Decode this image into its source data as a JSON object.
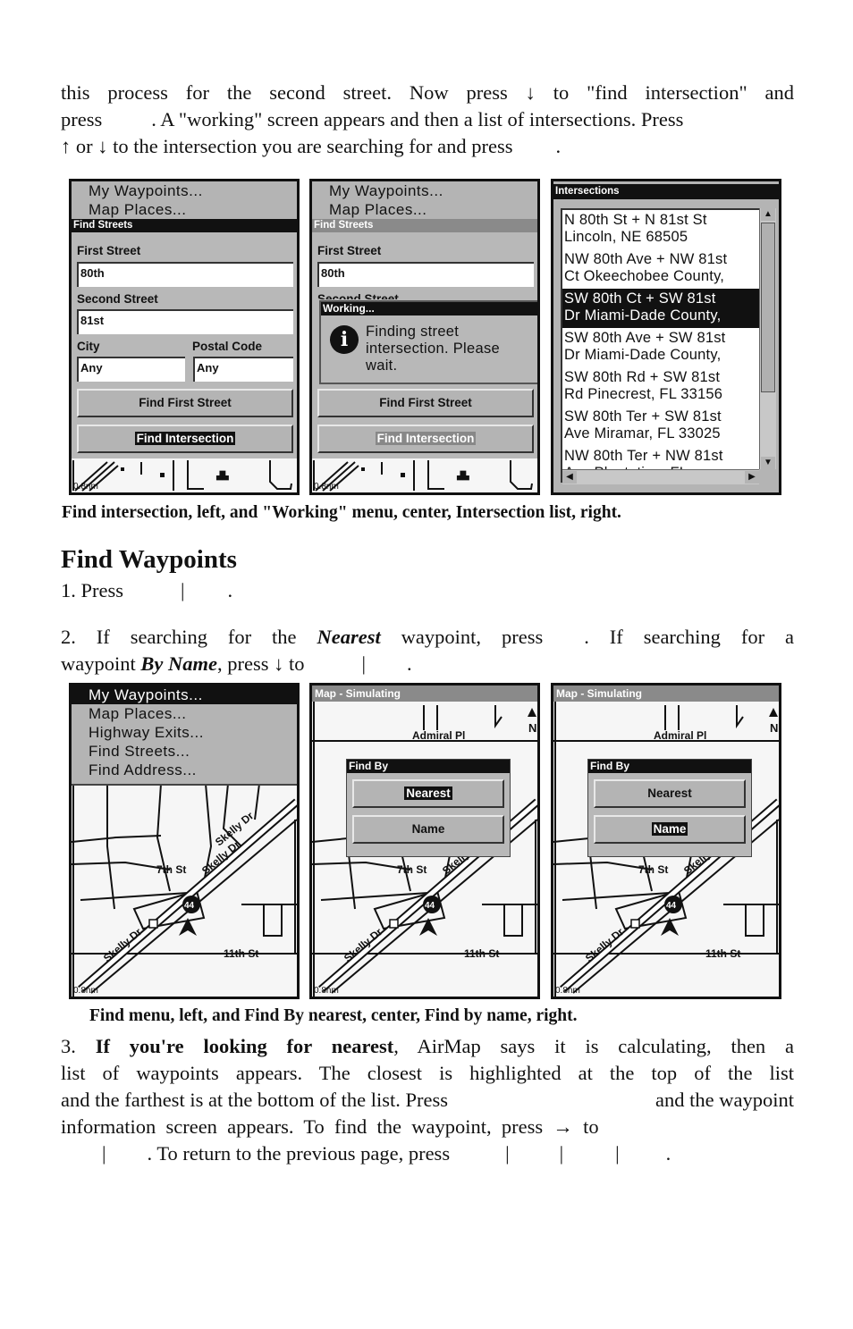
{
  "intro": {
    "line1": "this process for the second street. Now press ↓ to \"find intersection\" and",
    "line2_a": "press",
    "line2_b": ". A \"working\" screen appears and then a list of intersections. Press",
    "line3_a": "↑ or ↓ to the intersection you are searching for and press",
    "line3_b": "."
  },
  "figure1": {
    "caption": "Find intersection, left, and \"Working\" menu, center, Intersection list, right.",
    "left": {
      "menu_items": [
        "My Waypoints...",
        "Map Places..."
      ],
      "dialog_title": "Find Streets",
      "first_street_label": "First Street",
      "first_street_value": "80th",
      "second_street_label": "Second Street",
      "second_street_value": "81st",
      "city_label": "City",
      "city_value": "Any",
      "postal_label": "Postal Code",
      "postal_value": "Any",
      "find_first_button": "Find First Street",
      "find_intersection_button": "Find Intersection",
      "scale": "0.8nm"
    },
    "center": {
      "menu_items": [
        "My Waypoints...",
        "Map Places..."
      ],
      "dialog_title": "Find Streets",
      "first_street_label": "First Street",
      "first_street_value": "80th",
      "second_street_label": "Second Street",
      "working_title": "Working...",
      "working_message": [
        "Finding street",
        "intersection.  Please",
        "wait."
      ],
      "find_first_button": "Find First Street",
      "find_intersection_button": "Find Intersection",
      "scale": "0.8nm"
    },
    "right": {
      "title": "Intersections",
      "items": [
        {
          "line1": "N 80th St + N 81st St",
          "line2": "Lincoln, NE  68505",
          "selected": false
        },
        {
          "line1": "NW 80th Ave + NW 81st",
          "line2": "Ct Okeechobee County,",
          "selected": false
        },
        {
          "line1": "SW 80th Ct + SW 81st",
          "line2": "Dr Miami-Dade County,",
          "selected": true
        },
        {
          "line1": "SW 80th Ave + SW 81st",
          "line2": "Dr Miami-Dade County,",
          "selected": false
        },
        {
          "line1": "SW 80th Rd + SW 81st",
          "line2": "Rd Pinecrest, FL  33156",
          "selected": false
        },
        {
          "line1": "SW 80th Ter + SW 81st",
          "line2": "Ave Miramar, FL  33025",
          "selected": false
        },
        {
          "line1": "NW 80th Ter + NW 81st",
          "line2": "Ave Plantation, FL",
          "selected": false
        }
      ]
    }
  },
  "section": {
    "title": "Find Waypoints",
    "step1": "1. Press",
    "step2_a": "2. If searching for the",
    "step2_nearest": "Nearest",
    "step2_b": "waypoint, press",
    "step2_c": ". If searching for a",
    "step2_d": "waypoint",
    "step2_byname": "By Name",
    "step2_e": ", press ↓ to",
    "sep": "|",
    "dot": "."
  },
  "figure2": {
    "caption": "Find menu, left, and Find By nearest, center, Find by name, right.",
    "left": {
      "menu_items": [
        "My Waypoints...",
        "Map Places...",
        "Highway Exits...",
        "Find Streets...",
        "Find Address..."
      ],
      "selected_index": 0
    },
    "map": {
      "title": "Map - Simulating",
      "street_admiral": "Admiral Pl",
      "street_7th": "7th St",
      "street_11th": "11th St",
      "street_skelly": "Skelly Dr",
      "highway": "44",
      "north": "N",
      "scale": "0.8nm"
    },
    "find_by": {
      "title": "Find By",
      "nearest": "Nearest",
      "name": "Name"
    }
  },
  "step3": {
    "num": "3.",
    "bold": "If you're looking for nearest",
    "l1_rest": ", AirMap says it is calculating, then a",
    "l2": "list of waypoints appears. The closest is highlighted at the top of the list",
    "l3_a": "and the farthest is at the bottom of the list. Press",
    "l3_b": "and the waypoint",
    "l4": "information  screen  appears.  To  find  the  waypoint,  press  →  to",
    "l5_a": ". To return to the previous page, press"
  }
}
